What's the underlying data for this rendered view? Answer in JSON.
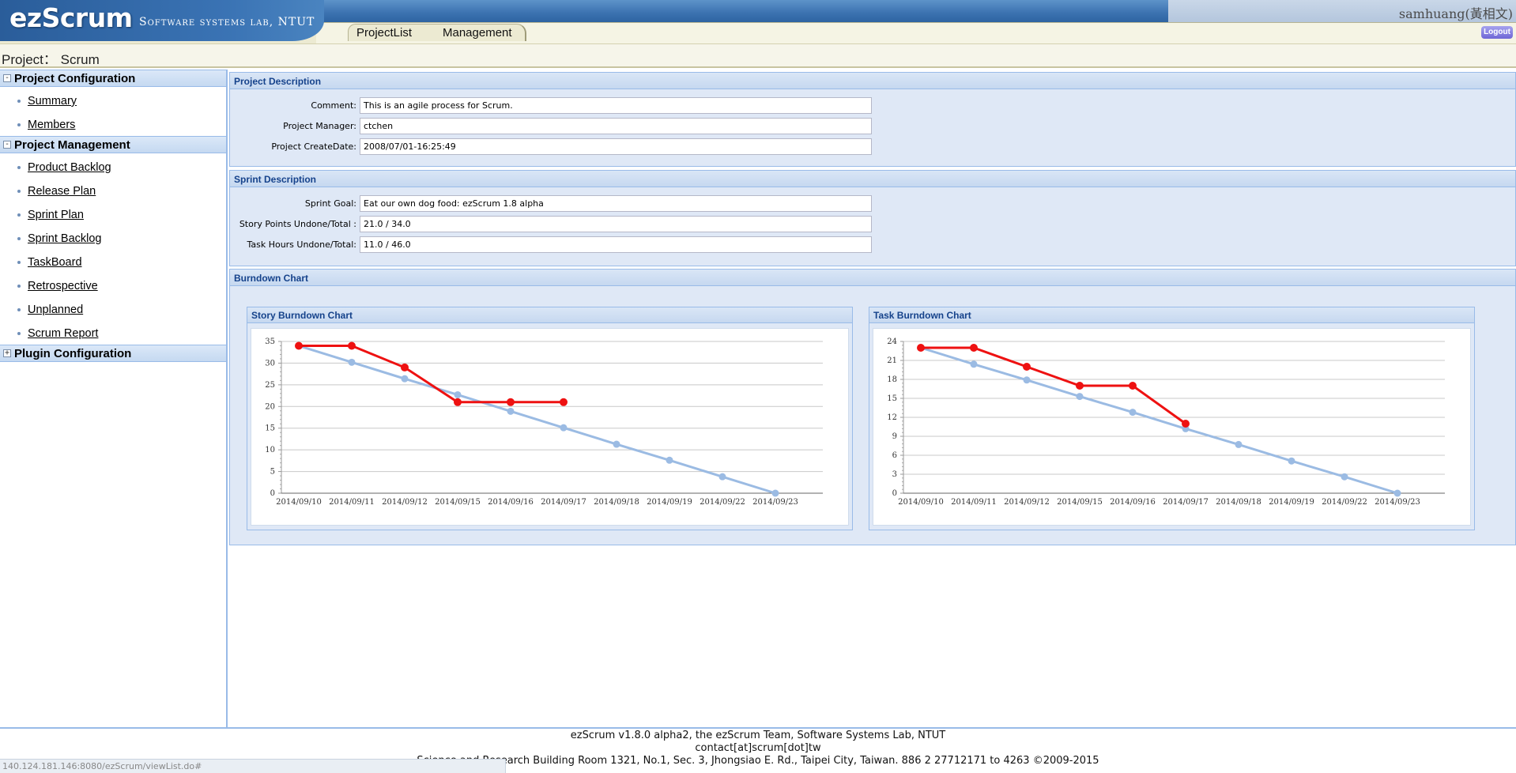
{
  "header": {
    "logo": "ezScrum",
    "subtitle": "Software systems lab, NTUT",
    "username": "samhuang(黃相文)",
    "tabs": [
      "ProjectList",
      "Management"
    ],
    "logout_label": "Logout"
  },
  "project_bar": {
    "label": "Project：  Scrum"
  },
  "sidebar": {
    "sections": [
      {
        "title": "Project Configuration",
        "toggle": "-",
        "items": [
          "Summary",
          "Members"
        ]
      },
      {
        "title": "Project Management",
        "toggle": "-",
        "items": [
          "Product Backlog",
          "Release Plan",
          "Sprint Plan",
          "Sprint Backlog",
          "TaskBoard",
          "Retrospective",
          "Unplanned",
          "Scrum Report"
        ]
      },
      {
        "title": "Plugin Configuration",
        "toggle": "+",
        "items": []
      }
    ]
  },
  "project_description": {
    "title": "Project Description",
    "fields": [
      {
        "label": "Comment:",
        "value": "This is an agile process for Scrum."
      },
      {
        "label": "Project Manager:",
        "value": "ctchen"
      },
      {
        "label": "Project CreateDate:",
        "value": "2008/07/01-16:25:49"
      }
    ]
  },
  "sprint_description": {
    "title": "Sprint Description",
    "fields": [
      {
        "label": "Sprint Goal:",
        "value": "Eat our own dog food: ezScrum 1.8 alpha"
      },
      {
        "label": "Story Points Undone/Total :",
        "value": "21.0 / 34.0"
      },
      {
        "label": "Task Hours Undone/Total:",
        "value": "11.0 / 46.0"
      }
    ]
  },
  "burndown": {
    "title": "Burndown Chart"
  },
  "chart_data": [
    {
      "type": "line",
      "title": "Story Burndown Chart",
      "categories": [
        "2014/09/10",
        "2014/09/11",
        "2014/09/12",
        "2014/09/15",
        "2014/09/16",
        "2014/09/17",
        "2014/09/18",
        "2014/09/19",
        "2014/09/22",
        "2014/09/23"
      ],
      "ylim": [
        0,
        35
      ],
      "yticks": [
        0,
        5,
        10,
        15,
        20,
        25,
        30,
        35
      ],
      "grid": true,
      "series": [
        {
          "color": "#9bbbe3",
          "values": [
            34,
            30.2,
            26.4,
            22.7,
            18.9,
            15.1,
            11.3,
            7.6,
            3.8,
            0
          ]
        },
        {
          "color": "#ee1111",
          "values": [
            34,
            34,
            29,
            21,
            21,
            21
          ]
        }
      ]
    },
    {
      "type": "line",
      "title": "Task Burndown Chart",
      "categories": [
        "2014/09/10",
        "2014/09/11",
        "2014/09/12",
        "2014/09/15",
        "2014/09/16",
        "2014/09/17",
        "2014/09/18",
        "2014/09/19",
        "2014/09/22",
        "2014/09/23"
      ],
      "ylim": [
        0,
        24
      ],
      "yticks": [
        0,
        3,
        6,
        9,
        12,
        15,
        18,
        21,
        24
      ],
      "grid": true,
      "series": [
        {
          "color": "#9bbbe3",
          "values": [
            23,
            20.4,
            17.9,
            15.3,
            12.8,
            10.2,
            7.7,
            5.1,
            2.6,
            0
          ]
        },
        {
          "color": "#ee1111",
          "values": [
            23,
            23,
            20,
            17,
            17,
            11
          ]
        }
      ]
    }
  ],
  "footer": {
    "line1": "ezScrum v1.8.0 alpha2, the ezScrum Team, Software Systems Lab, NTUT",
    "line2": "contact[at]scrum[dot]tw",
    "line3": "Science and Research Building Room 1321, No.1, Sec. 3, Jhongsiao E. Rd., Taipei City, Taiwan. 886 2 27712171 to 4263 ©2009-2015"
  },
  "status_url": "140.124.181.146:8080/ezScrum/viewList.do#"
}
